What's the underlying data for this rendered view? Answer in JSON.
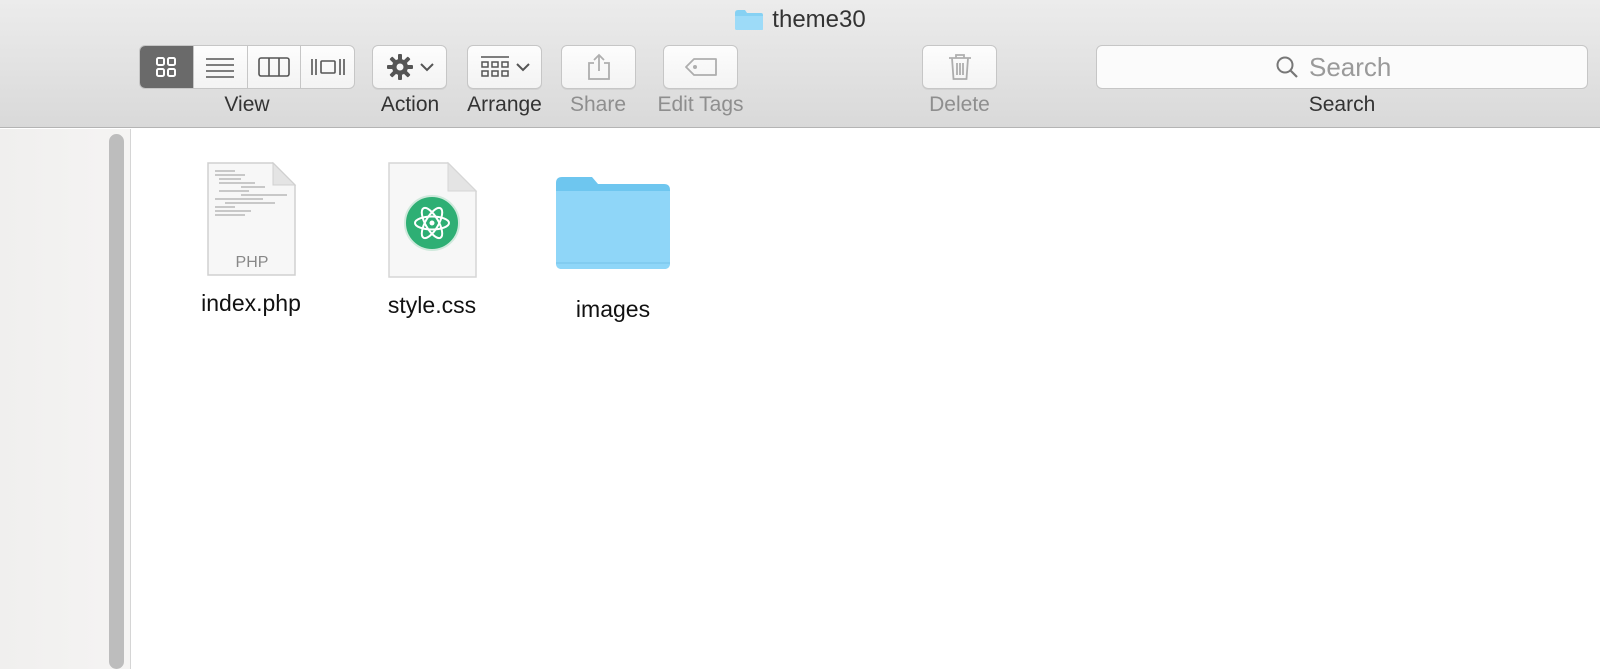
{
  "window": {
    "title": "theme30"
  },
  "toolbar": {
    "view_label": "View",
    "action_label": "Action",
    "arrange_label": "Arrange",
    "share_label": "Share",
    "edit_tags_label": "Edit Tags",
    "delete_label": "Delete",
    "search_label": "Search",
    "search_placeholder": "Search",
    "view_modes": [
      "icon-view",
      "list-view",
      "column-view",
      "cover-flow-view"
    ],
    "active_view": "icon-view"
  },
  "files": [
    {
      "name": "index.php",
      "kind": "php-document",
      "badge": "PHP"
    },
    {
      "name": "style.css",
      "kind": "css-document-atom"
    },
    {
      "name": "images",
      "kind": "folder"
    }
  ],
  "colors": {
    "folder": "#7fcff5",
    "atom": "#2eaf74",
    "active_segment": "#6a6a6a"
  }
}
